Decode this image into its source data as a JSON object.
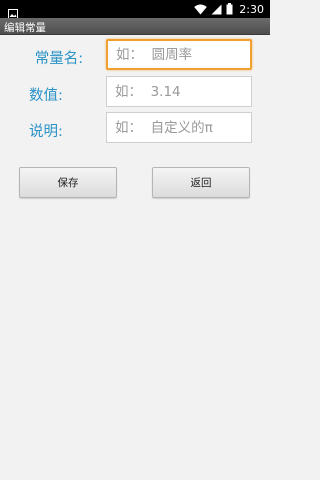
{
  "status_bar": {
    "time": "2:30",
    "icons": [
      "image-icon",
      "wifi-icon",
      "signal-icon",
      "battery-icon"
    ]
  },
  "title_bar": {
    "title": "编辑常量"
  },
  "form": {
    "name_label": "常量名:",
    "name_placeholder": "如：  圆周率",
    "value_label": "数值:",
    "value_placeholder": "如：  3.14",
    "desc_label": "说明:",
    "desc_placeholder": "如：  自定义的π"
  },
  "buttons": {
    "save_label": "保存",
    "back_label": "返回"
  },
  "colors": {
    "label_blue": "#2a93c8",
    "focus_orange": "#f0a030",
    "title_bar": "#5a5a5a"
  }
}
